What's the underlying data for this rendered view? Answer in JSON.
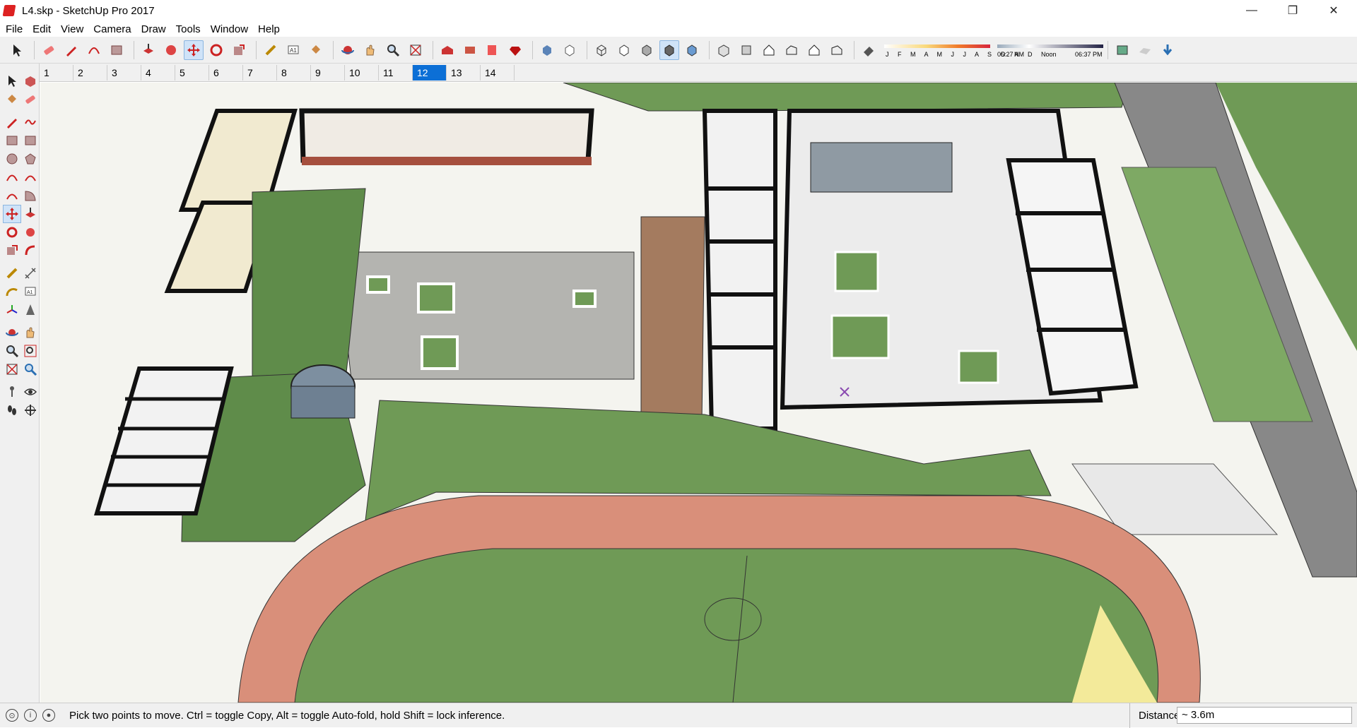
{
  "window": {
    "title": "L4.skp - SketchUp Pro 2017",
    "minimize": "—",
    "maximize": "❐",
    "close": "✕"
  },
  "menu": [
    "File",
    "Edit",
    "View",
    "Camera",
    "Draw",
    "Tools",
    "Window",
    "Help"
  ],
  "shadows": {
    "months": "J F M A M J J A S O N D",
    "time_start": "05:27 AM",
    "time_mid": "Noon",
    "time_end": "06:37 PM"
  },
  "scenes": {
    "tabs": [
      "1",
      "2",
      "3",
      "4",
      "5",
      "6",
      "7",
      "8",
      "9",
      "10",
      "11",
      "12",
      "13",
      "14"
    ],
    "active": "12"
  },
  "status": {
    "text": "Pick two points to move.  Ctrl = toggle Copy, Alt = toggle Auto-fold, hold Shift = lock inference.",
    "measure_label": "Distance",
    "measure_value": "~ 3.6m"
  },
  "colors": {
    "accent": "#0c6fd6",
    "grass": "#5e8c4a",
    "track": "#d98f7a",
    "wall": "#1b1b1b",
    "brick": "#a54f3e"
  },
  "icons": [
    "select-icon",
    "eraser-icon",
    "pencil-icon",
    "arc-icon",
    "rectangle-icon",
    "push-pull-icon",
    "follow-me-icon",
    "move-icon",
    "rotate-icon",
    "scale-icon",
    "tape-measure-icon",
    "text-icon",
    "paint-bucket-icon",
    "orbit-icon",
    "pan-icon",
    "zoom-icon",
    "zoom-extents-icon"
  ]
}
